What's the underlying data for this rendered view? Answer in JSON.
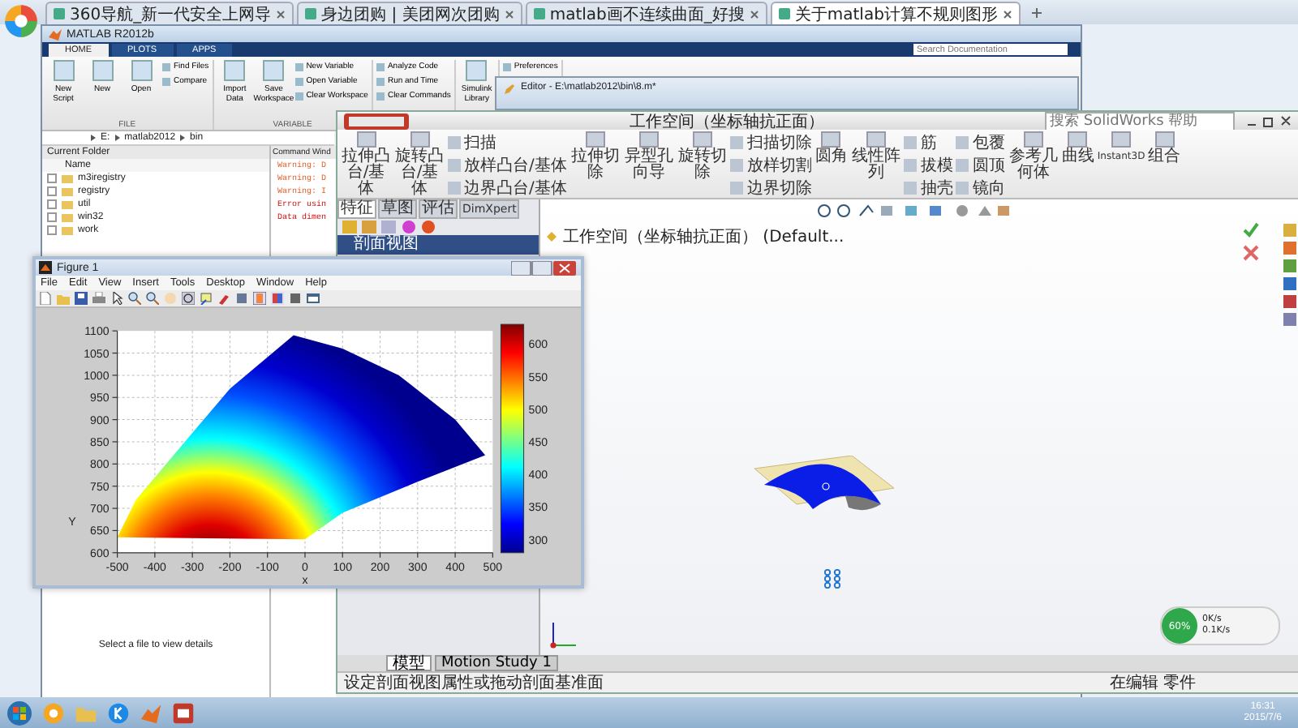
{
  "browser": {
    "tabs": [
      {
        "label": "360导航_新一代安全上网导",
        "selected": false
      },
      {
        "label": "身边团购 | 美团网次团购",
        "selected": false
      },
      {
        "label": "matlab画不连续曲面_好搜",
        "selected": false
      },
      {
        "label": "关于matlab计算不规则图形",
        "selected": true
      }
    ]
  },
  "matlab": {
    "title": "MATLAB R2012b",
    "tabs": [
      {
        "label": "HOME",
        "selected": true
      },
      {
        "label": "PLOTS",
        "selected": false
      },
      {
        "label": "APPS",
        "selected": false
      }
    ],
    "search": {
      "placeholder": "Search Documentation"
    },
    "toolstrip": [
      {
        "label": "FILE",
        "items": [
          {
            "kind": "large",
            "label": "New Script"
          },
          {
            "kind": "large",
            "label": "New"
          },
          {
            "kind": "large",
            "label": "Open"
          },
          {
            "kind": "small",
            "labels": [
              "Find Files",
              "Compare"
            ]
          }
        ]
      },
      {
        "label": "VARIABLE",
        "items": [
          {
            "kind": "large",
            "label": "Import Data"
          },
          {
            "kind": "large",
            "label": "Save Workspace"
          },
          {
            "kind": "small",
            "labels": [
              "New Variable",
              "Open Variable",
              "Clear Workspace"
            ]
          }
        ]
      },
      {
        "items": [
          {
            "kind": "small",
            "labels": [
              "Analyze Code",
              "Run and Time",
              "Clear Commands"
            ]
          }
        ]
      },
      {
        "items": [
          {
            "kind": "large",
            "label": "Simulink Library"
          }
        ]
      },
      {
        "items": [
          {
            "kind": "small",
            "labels": [
              "Preferences"
            ]
          }
        ]
      }
    ],
    "path": [
      "E:",
      "matlab2012",
      "bin"
    ],
    "current_folder": {
      "title": "Current Folder",
      "column": "Name",
      "items": [
        "m3iregistry",
        "registry",
        "util",
        "win32",
        "work"
      ],
      "details": "Select a file to view details"
    },
    "command_window": {
      "title": "Command Wind",
      "lines": [
        {
          "kind": "warning",
          "text": "Warning: D"
        },
        {
          "kind": "warning",
          "text": "Warning: D"
        },
        {
          "kind": "warning",
          "text": "Warning: I"
        },
        {
          "kind": "error",
          "text": "Error usin"
        },
        {
          "kind": "error",
          "text": "Data dimen"
        }
      ]
    }
  },
  "editor": {
    "title": "Editor - E:\\matlab2012\\bin\\8.m*"
  },
  "solidworks": {
    "title": "工作空间（坐标轴抗正面）",
    "search": {
      "placeholder": "搜索 SolidWorks 帮助"
    },
    "ribbon": [
      {
        "kind": "large",
        "label": "拉伸凸台/基体"
      },
      {
        "kind": "large",
        "label": "旋转凸台/基体"
      },
      {
        "kind": "small",
        "labels": [
          "扫描",
          "放样凸台/基体",
          "边界凸台/基体"
        ]
      },
      {
        "kind": "large",
        "label": "拉伸切除"
      },
      {
        "kind": "large",
        "label": "异型孔向导"
      },
      {
        "kind": "large",
        "label": "旋转切除"
      },
      {
        "kind": "small",
        "labels": [
          "扫描切除",
          "放样切割",
          "边界切除"
        ]
      },
      {
        "kind": "large",
        "label": "圆角"
      },
      {
        "kind": "large",
        "label": "线性阵列"
      },
      {
        "kind": "small",
        "labels": [
          "筋",
          "拔模",
          "抽壳"
        ]
      },
      {
        "kind": "small",
        "labels": [
          "包覆",
          "圆顶",
          "镜向"
        ]
      },
      {
        "kind": "large",
        "label": "参考几何体"
      },
      {
        "kind": "large",
        "label": "曲线"
      },
      {
        "kind": "large",
        "label": "Instant3D"
      },
      {
        "kind": "large",
        "label": "组合"
      }
    ],
    "tabs": [
      {
        "label": "特征",
        "selected": true
      },
      {
        "label": "草图",
        "selected": false
      },
      {
        "label": "评估",
        "selected": false
      },
      {
        "label": "DimXpert",
        "selected": false
      }
    ],
    "panel_title": "剖面视图",
    "tree_root": "工作空间（坐标轴抗正面） (Default...",
    "bottom_tabs": [
      {
        "label": "模型",
        "selected": true
      },
      {
        "label": "Motion Study 1",
        "selected": false
      }
    ],
    "status": "设定剖面视图属性或拖动剖面基准面",
    "mode": "在编辑 零件",
    "network": {
      "percent": "60%",
      "up": "0K/s",
      "down": "0.1K/s"
    }
  },
  "figure": {
    "title": "Figure 1",
    "menu": [
      "File",
      "Edit",
      "View",
      "Insert",
      "Tools",
      "Desktop",
      "Window",
      "Help"
    ],
    "xticks": [
      "-500",
      "-400",
      "-300",
      "-200",
      "-100",
      "0",
      "100",
      "200",
      "300",
      "400",
      "500"
    ],
    "yticks": [
      "1100",
      "1050",
      "1000",
      "950",
      "900",
      "850",
      "800",
      "750",
      "700",
      "650",
      "600"
    ],
    "colorbar_ticks": [
      "600",
      "550",
      "500",
      "450",
      "400",
      "350",
      "300"
    ],
    "xlabel": "x",
    "ylabel": "Y"
  },
  "taskbar": {
    "time": "16:31",
    "date": "2015/7/6"
  }
}
